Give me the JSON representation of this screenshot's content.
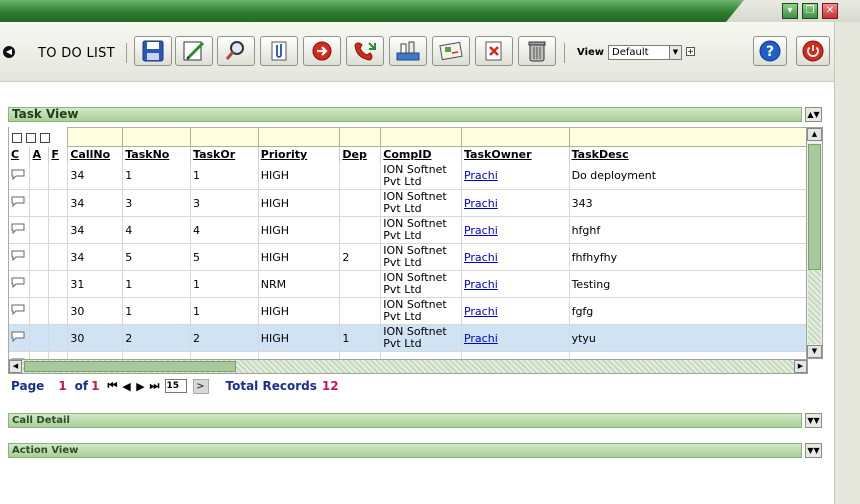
{
  "app": {
    "title": "TO DO LIST"
  },
  "toolbar": {
    "view_label": "View",
    "view_selected": "Default",
    "buttons": [
      {
        "icon": "save-icon"
      },
      {
        "icon": "edit-icon"
      },
      {
        "icon": "search-icon"
      },
      {
        "icon": "attach-icon"
      },
      {
        "icon": "forward-icon"
      },
      {
        "icon": "call-icon"
      },
      {
        "icon": "hierarchy-icon"
      },
      {
        "icon": "card-icon"
      },
      {
        "icon": "cancel-icon"
      },
      {
        "icon": "delete-icon"
      }
    ]
  },
  "task_view": {
    "title": "Task View",
    "columns": [
      "C",
      "A",
      "F",
      "CallNo",
      "TaskNo",
      "TaskOr",
      "Priority",
      "Dep",
      "CompID",
      "TaskOwner",
      "TaskDesc"
    ],
    "rows": [
      {
        "callno": "34",
        "taskno": "1",
        "taskor": "1",
        "priority": "HIGH",
        "dep": "",
        "compid": "ION Softnet Pvt Ltd",
        "owner": "Prachi",
        "desc": "Do deployment"
      },
      {
        "callno": "34",
        "taskno": "3",
        "taskor": "3",
        "priority": "HIGH",
        "dep": "",
        "compid": "ION Softnet Pvt Ltd",
        "owner": "Prachi",
        "desc": "343"
      },
      {
        "callno": "34",
        "taskno": "4",
        "taskor": "4",
        "priority": "HIGH",
        "dep": "",
        "compid": "ION Softnet Pvt Ltd",
        "owner": "Prachi",
        "desc": "hfghf"
      },
      {
        "callno": "34",
        "taskno": "5",
        "taskor": "5",
        "priority": "HIGH",
        "dep": "2",
        "compid": "ION Softnet Pvt Ltd",
        "owner": "Prachi",
        "desc": "fhfhyfhy"
      },
      {
        "callno": "31",
        "taskno": "1",
        "taskor": "1",
        "priority": "NRM",
        "dep": "",
        "compid": "ION Softnet Pvt Ltd",
        "owner": "Prachi",
        "desc": "Testing"
      },
      {
        "callno": "30",
        "taskno": "1",
        "taskor": "1",
        "priority": "HIGH",
        "dep": "",
        "compid": "ION Softnet Pvt Ltd",
        "owner": "Prachi",
        "desc": "fgfg"
      },
      {
        "callno": "30",
        "taskno": "2",
        "taskor": "2",
        "priority": "HIGH",
        "dep": "1",
        "compid": "ION Softnet Pvt Ltd",
        "owner": "Prachi",
        "desc": "ytyu",
        "selected": true
      },
      {
        "callno": "",
        "taskno": "",
        "taskor": "",
        "priority": "",
        "dep": "",
        "compid": "ION Softnet",
        "owner": "",
        "desc": ""
      }
    ]
  },
  "pager": {
    "page_label": "Page",
    "page": "1",
    "of_label": "of",
    "total_pages": "1",
    "page_size": "15",
    "go_label": ">",
    "total_label": "Total Records",
    "total_records": "12"
  },
  "call_detail": {
    "title": "Call Detail"
  },
  "action_view": {
    "title": "Action View"
  },
  "colors": {
    "title_green": "#2f7d2f",
    "header_green": "#a8cf98",
    "link_blue": "#0000cc",
    "pager_blue": "#1b2e8c",
    "pager_red": "#c2185b",
    "selected_row": "#cfe3f5"
  }
}
